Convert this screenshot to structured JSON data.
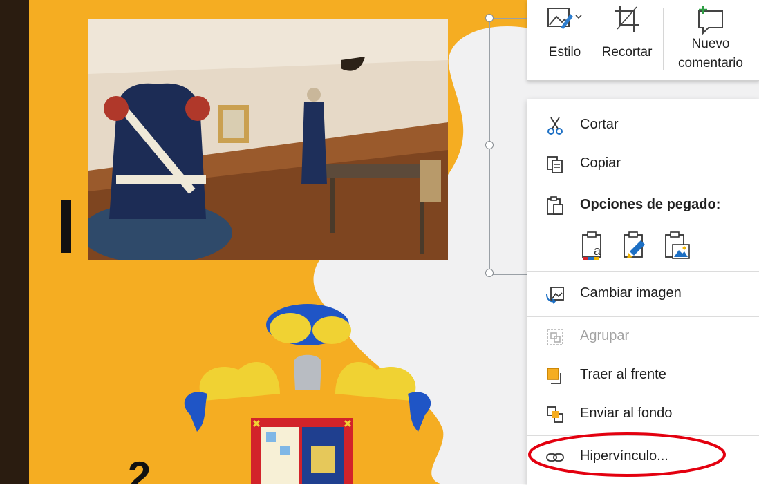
{
  "toolbar": {
    "estilo_label": "Estilo",
    "recortar_label": "Recortar",
    "nuevo_comentario_line1": "Nuevo",
    "nuevo_comentario_line2": "comentario"
  },
  "context_menu": {
    "cortar_label": "Cortar",
    "copiar_label": "Copiar",
    "paste_header": "Opciones de pegado:",
    "cambiar_imagen_label": "Cambiar imagen",
    "agrupar_label": "Agrupar",
    "traer_label": "Traer al frente",
    "enviar_label": "Enviar al fondo",
    "hipervinculo_label": "Hipervínculo..."
  },
  "slide": {
    "number_partial": "2"
  },
  "colors": {
    "slide_orange": "#f5ad22",
    "dark_bar": "#2a1c10",
    "highlight_red": "#e3000f",
    "paste_blue": "#1c6fc4"
  }
}
